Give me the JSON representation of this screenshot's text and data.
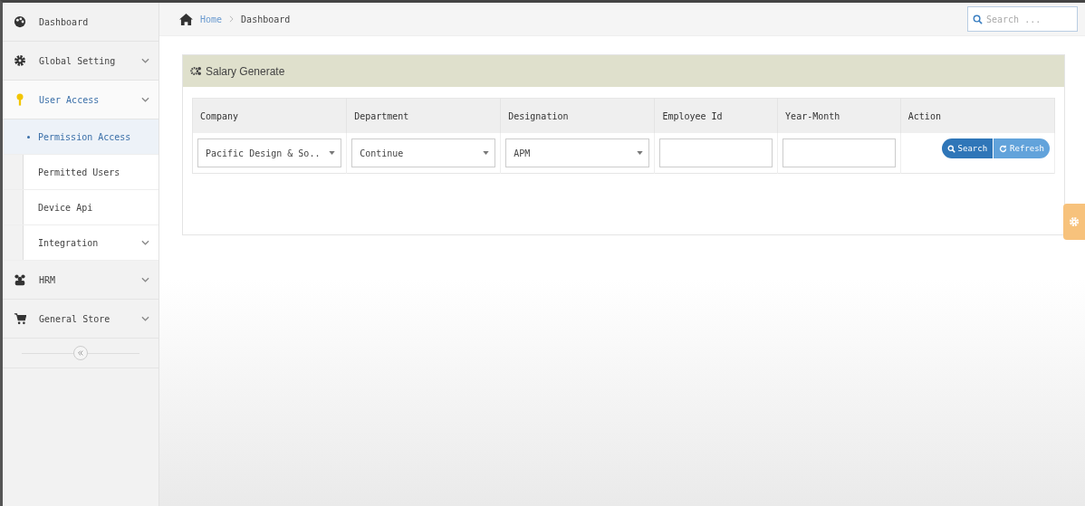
{
  "sidebar": {
    "items": [
      {
        "label": "Dashboard",
        "kind": "link",
        "selected": false
      },
      {
        "label": "Global Setting",
        "kind": "group",
        "expanded": false,
        "selected": false
      },
      {
        "label": "User Access",
        "kind": "group",
        "expanded": true,
        "selected": false,
        "children": [
          {
            "label": "Permission Access",
            "kind": "link",
            "selected": true
          },
          {
            "label": "Permitted Users",
            "kind": "link",
            "selected": false
          },
          {
            "label": "Device Api",
            "kind": "link",
            "selected": false
          },
          {
            "label": "Integration",
            "kind": "group",
            "expanded": false,
            "selected": false
          }
        ]
      },
      {
        "label": "HRM",
        "kind": "group",
        "expanded": false,
        "selected": false
      },
      {
        "label": "General Store",
        "kind": "group",
        "expanded": false,
        "selected": false
      }
    ]
  },
  "breadcrumb": [
    "Home",
    "Dashboard"
  ],
  "search": {
    "placeholder": "Search ..."
  },
  "panel": {
    "title": "Salary Generate",
    "table": {
      "columns": [
        "Company",
        "Department",
        "Designation",
        "Employee Id",
        "Year-Month",
        "Action"
      ],
      "fields": [
        {
          "kind": "select",
          "value": "Pacific Design & So.."
        },
        {
          "kind": "select",
          "value": "Continue"
        },
        {
          "kind": "select",
          "value": "APM"
        },
        {
          "kind": "input"
        },
        {
          "kind": "input"
        }
      ],
      "buttons": [
        {
          "label": "Search",
          "kind": "search"
        },
        {
          "label": "Refresh",
          "kind": "refresh"
        }
      ]
    }
  }
}
